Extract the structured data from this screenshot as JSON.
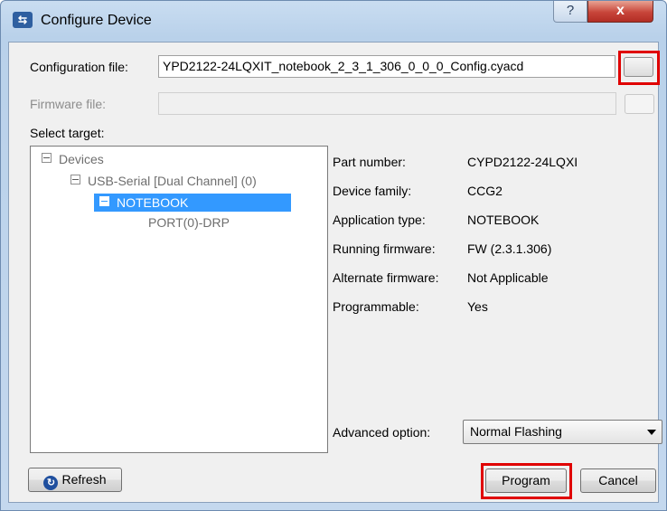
{
  "window": {
    "title": "Configure Device",
    "help_glyph": "?",
    "close_glyph": "x",
    "app_icon": "device-icon"
  },
  "config": {
    "label": "Configuration file:",
    "value": "YPD2122-24LQXIT_notebook_2_3_1_306_0_0_0_Config.cyacd",
    "browse_label": ""
  },
  "firmware": {
    "label": "Firmware file:",
    "value": ""
  },
  "target": {
    "label": "Select target:"
  },
  "tree": {
    "root": "Devices",
    "device": "USB-Serial [Dual Channel] (0)",
    "selected": "NOTEBOOK",
    "port": "PORT(0)-DRP"
  },
  "properties": {
    "part_number": {
      "label": "Part number:",
      "value": "CYPD2122-24LQXI"
    },
    "device_family": {
      "label": "Device family:",
      "value": "CCG2"
    },
    "application_type": {
      "label": "Application type:",
      "value": "NOTEBOOK"
    },
    "running_firmware": {
      "label": "Running firmware:",
      "value": "FW (2.3.1.306)"
    },
    "alternate_firmware": {
      "label": "Alternate firmware:",
      "value": "Not Applicable"
    },
    "programmable": {
      "label": "Programmable:",
      "value": "Yes"
    }
  },
  "advanced": {
    "label": "Advanced option:",
    "selected": "Normal Flashing"
  },
  "buttons": {
    "refresh": "Refresh",
    "program": "Program",
    "cancel": "Cancel"
  },
  "colors": {
    "highlight": "#e00000",
    "selection": "#3399ff"
  }
}
